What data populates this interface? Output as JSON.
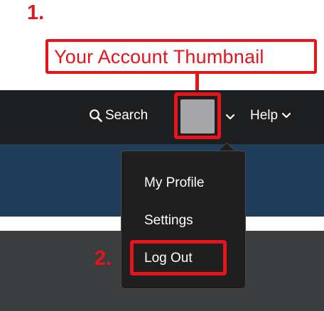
{
  "annotations": {
    "step1_label": "1.",
    "callout_text": "Your Account Thumbnail",
    "step2_label": "2.",
    "highlight_color": "#e8141b"
  },
  "navbar": {
    "search_label": "Search",
    "search_icon": "search-icon",
    "account_thumbnail_icon": "account-thumbnail",
    "account_caret_icon": "chevron-down-icon",
    "help_label": "Help",
    "help_caret_icon": "chevron-down-icon",
    "background_color": "#1d1e1f"
  },
  "account_menu": {
    "items": [
      {
        "label": "My Profile"
      },
      {
        "label": "Settings"
      },
      {
        "label": "Log Out"
      }
    ],
    "background_color": "#1f1f20"
  },
  "page": {
    "banner_color": "#1f3d5b",
    "lower_panel_color": "#3c3d3e"
  }
}
